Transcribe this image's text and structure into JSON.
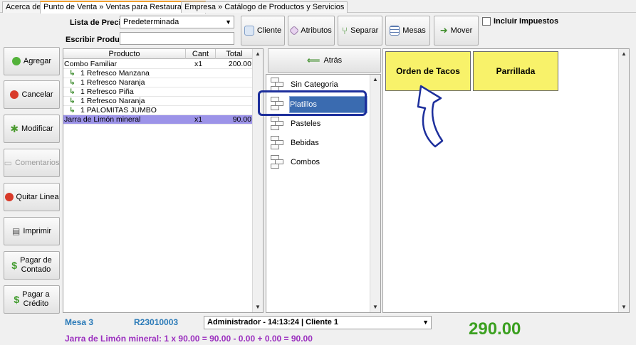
{
  "tabs": [
    {
      "label": "Acerca de"
    },
    {
      "label": "Punto de Venta » Ventas para Restaurante",
      "close": "✕"
    },
    {
      "label": "Empresa » Catálogo de Productos y Servicios"
    }
  ],
  "header": {
    "price_list_label": "Lista de Precios",
    "price_list_value": "Predeterminada",
    "write_product_label": "Escribir Producto",
    "write_product_value": ""
  },
  "toolbar": {
    "cliente": "Cliente",
    "atributos": "Atributos",
    "separar": "Separar",
    "mesas": "Mesas",
    "mover": "Mover",
    "incluir_impuestos": "Incluir Impuestos"
  },
  "left_buttons": {
    "agregar": "Agregar",
    "cancelar": "Cancelar",
    "modificar": "Modificar",
    "comentarios": "Comentarios",
    "quitar_linea": "Quitar Linea",
    "imprimir": "Imprimir",
    "pagar_contado_1": "Pagar de",
    "pagar_contado_2": "Contado",
    "pagar_credito_1": "Pagar a",
    "pagar_credito_2": "Crédito"
  },
  "grid": {
    "columns": [
      "Producto",
      "Cant",
      "Total"
    ],
    "rows": [
      {
        "producto": "Combo Familiar",
        "cant": "x1",
        "total": "200.00"
      },
      {
        "producto": "1 Refresco  Manzana",
        "cant": "",
        "total": ""
      },
      {
        "producto": "1 Refresco  Naranja",
        "cant": "",
        "total": ""
      },
      {
        "producto": "1 Refresco Piña",
        "cant": "",
        "total": ""
      },
      {
        "producto": "1 Refresco  Naranja",
        "cant": "",
        "total": ""
      },
      {
        "producto": "1 PALOMITAS JUMBO",
        "cant": "",
        "total": ""
      },
      {
        "producto": "Jarra de Limón mineral",
        "cant": "x1",
        "total": "90.00"
      }
    ]
  },
  "categories": {
    "back_label": "Atrás",
    "items": [
      "Sin Categoria",
      "Platillos",
      "Pasteles",
      "Bebidas",
      "Combos"
    ],
    "selected": "Platillos"
  },
  "products": [
    "Orden de Tacos",
    "Parrillada"
  ],
  "footer": {
    "mesa": "Mesa 3",
    "folio": "R23010003",
    "user_session": "Administrador - 14:13:24 | Cliente 1",
    "total": "290.00",
    "detail": "Jarra de Limón mineral: 1 x 90.00 = 90.00 - 0.00 + 0.00 = 90.00"
  },
  "colors": {
    "product_tile": "#f8f26a",
    "selected_category": "#3a6bb0",
    "selected_row": "#9c93e8",
    "total_green": "#3ba020",
    "detail_purple": "#9b2fbf",
    "highlight_box": "#1d2f9c",
    "arrow_blue": "#1d2f9c"
  }
}
